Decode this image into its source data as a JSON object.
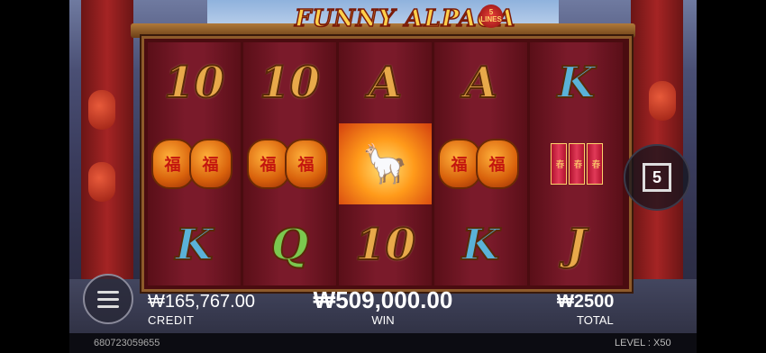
{
  "game": {
    "title": "FUNNY ALPACA",
    "lines_badge": "5 LINES"
  },
  "reels": [
    [
      {
        "type": "text",
        "text": "10",
        "color": "gold"
      },
      {
        "type": "lanterns",
        "text": "福"
      },
      {
        "type": "text",
        "text": "K",
        "color": "blue"
      }
    ],
    [
      {
        "type": "text",
        "text": "10",
        "color": "gold"
      },
      {
        "type": "lanterns",
        "text": "福"
      },
      {
        "type": "text",
        "text": "Q",
        "color": "green"
      }
    ],
    [
      {
        "type": "text",
        "text": "A",
        "color": "gold"
      },
      {
        "type": "alpaca",
        "text": "🦙"
      },
      {
        "type": "text",
        "text": "10",
        "color": "gold"
      }
    ],
    [
      {
        "type": "text",
        "text": "A",
        "color": "gold"
      },
      {
        "type": "lanterns",
        "text": "福"
      },
      {
        "type": "text",
        "text": "K",
        "color": "blue"
      }
    ],
    [
      {
        "type": "text",
        "text": "K",
        "color": "blue"
      },
      {
        "type": "firecracker",
        "text": "春"
      },
      {
        "type": "text",
        "text": "J",
        "color": "gold"
      }
    ]
  ],
  "lines_button": {
    "value": "5"
  },
  "credit": {
    "value": "₩165,767.00",
    "label": "CREDIT"
  },
  "win": {
    "value": "₩509,000.00",
    "label": "WIN"
  },
  "total": {
    "value": "₩2500",
    "label": "TOTAL"
  },
  "footer": {
    "round_id": "680723059655",
    "level": "LEVEL : X50"
  },
  "icons": {
    "menu": "hamburger-menu-icon"
  }
}
